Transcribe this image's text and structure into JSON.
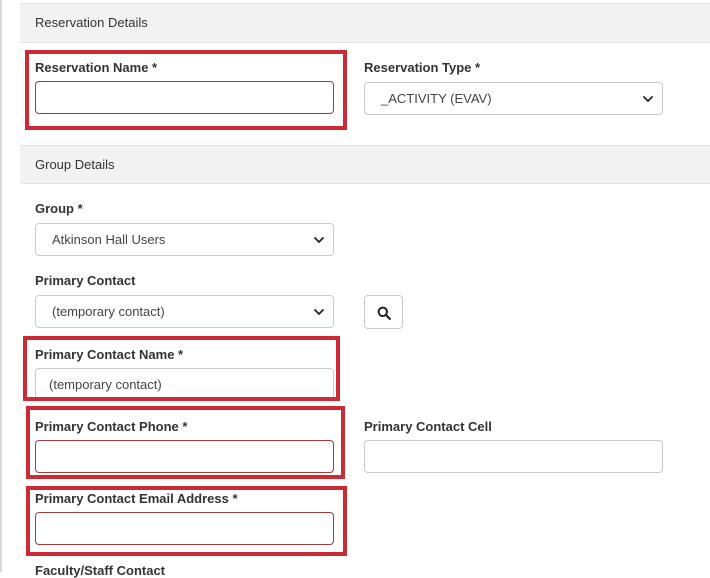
{
  "sections": {
    "reservation_details": "Reservation Details",
    "group_details": "Group Details"
  },
  "fields": {
    "reservation_name": {
      "label": "Reservation Name *",
      "value": ""
    },
    "reservation_type": {
      "label": "Reservation Type *",
      "selected": "_ACTIVITY (EVAV)"
    },
    "group": {
      "label": "Group *",
      "selected": "Atkinson Hall Users"
    },
    "primary_contact": {
      "label": "Primary Contact",
      "selected": "(temporary contact)"
    },
    "primary_contact_name": {
      "label": "Primary Contact Name *",
      "value": "(temporary contact)"
    },
    "primary_contact_phone": {
      "label": "Primary Contact Phone *",
      "value": ""
    },
    "primary_contact_cell": {
      "label": "Primary Contact Cell",
      "value": ""
    },
    "primary_contact_email": {
      "label": "Primary Contact Email Address *",
      "value": ""
    },
    "faculty_staff_contact": {
      "label": "Faculty/Staff Contact"
    }
  },
  "icons": {
    "search": "search-icon",
    "dropdown": "chevron-down-icon"
  },
  "colors": {
    "highlight": "#cc2b35",
    "error_border": "#a83a3a",
    "section_bg": "#f2f2f2"
  }
}
